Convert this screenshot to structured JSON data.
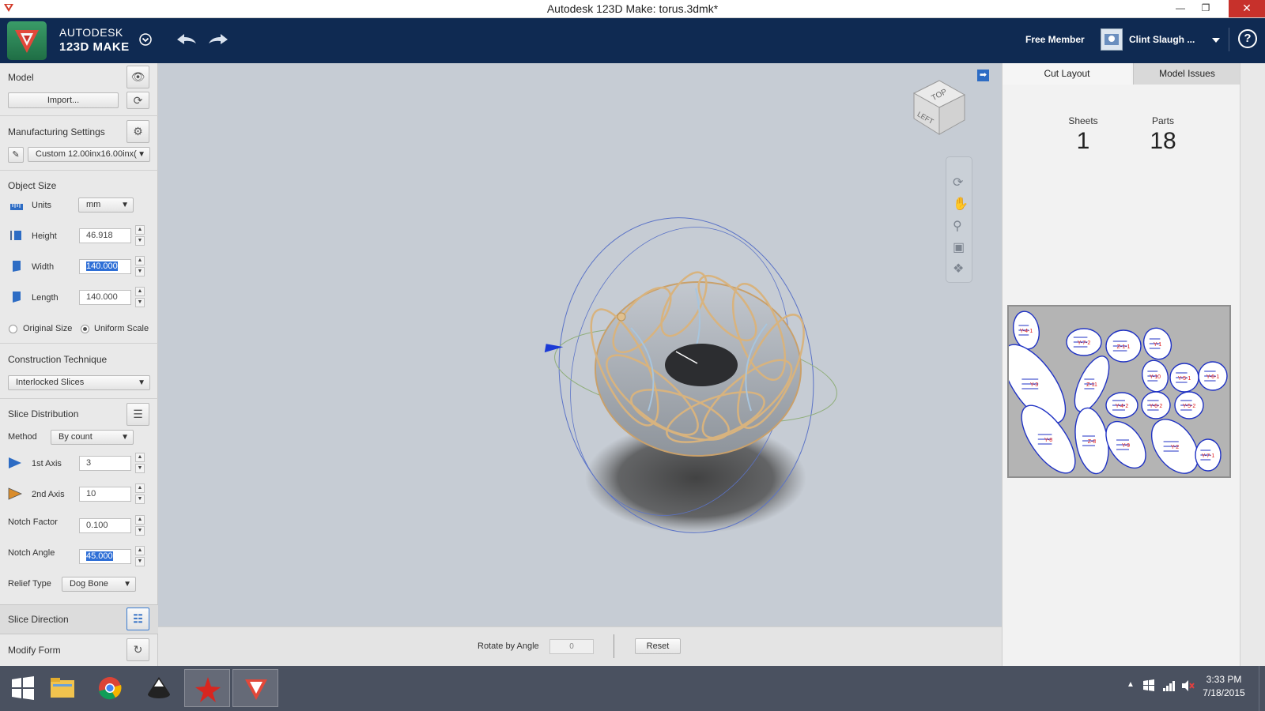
{
  "window": {
    "title": "Autodesk 123D Make: torus.3dmk*"
  },
  "header": {
    "brand_line1": "AUTODESK",
    "brand_line2": "123D MAKE",
    "membership": "Free Member",
    "username": "Clint Slaugh ...",
    "help_label": "?"
  },
  "left_panel": {
    "model": {
      "title": "Model",
      "import_label": "Import..."
    },
    "manufacturing": {
      "title": "Manufacturing Settings",
      "preset": "Custom 12.00inx16.00inx("
    },
    "object_size": {
      "title": "Object Size",
      "units_label": "Units",
      "units_value": "mm",
      "height_label": "Height",
      "height_value": "46.918",
      "width_label": "Width",
      "width_value": "140.000",
      "length_label": "Length",
      "length_value": "140.000",
      "original_size_label": "Original Size",
      "uniform_scale_label": "Uniform Scale"
    },
    "construction": {
      "title": "Construction Technique",
      "value": "Interlocked Slices"
    },
    "slice_distribution": {
      "title": "Slice Distribution",
      "method_label": "Method",
      "method_value": "By count",
      "axis1_label": "1st Axis",
      "axis1_value": "3",
      "axis2_label": "2nd Axis",
      "axis2_value": "10",
      "notch_factor_label": "Notch Factor",
      "notch_factor_value": "0.100",
      "notch_angle_label": "Notch Angle",
      "notch_angle_value": "45.000",
      "relief_label": "Relief Type",
      "relief_value": "Dog Bone"
    },
    "slice_direction": {
      "title": "Slice Direction"
    },
    "modify_form": {
      "title": "Modify Form"
    }
  },
  "viewcube": {
    "top": "TOP",
    "left": "LEFT"
  },
  "bottom_bar": {
    "rotate_label": "Rotate by  Angle",
    "rotate_value": "0",
    "reset_label": "Reset"
  },
  "right_panel": {
    "tabs": [
      {
        "label": "Cut Layout"
      },
      {
        "label": "Model Issues"
      }
    ],
    "sheets_label": "Sheets",
    "sheets_value": "1",
    "parts_label": "Parts",
    "parts_value": "18",
    "part_labels": [
      "Y-4-1",
      "Y-7-2",
      "Z-1-1",
      "Y-1",
      "Y-3",
      "Y-10",
      "Y-5-1",
      "Y-6-1",
      "Z-11",
      "Y-4-2",
      "Y-6-2",
      "Y-5-2",
      "Z-8",
      "Y-9",
      "Y-8",
      "Y-2",
      "Y-7-1"
    ]
  },
  "taskbar": {
    "time": "3:33 PM",
    "date": "7/18/2015"
  },
  "colors": {
    "header_bg": "#0f2a52",
    "accent_blue": "#1f5fbf",
    "panel_bg": "#e9e9e9",
    "viewport_bg": "#c6ccd4",
    "close_red": "#c7312b"
  }
}
